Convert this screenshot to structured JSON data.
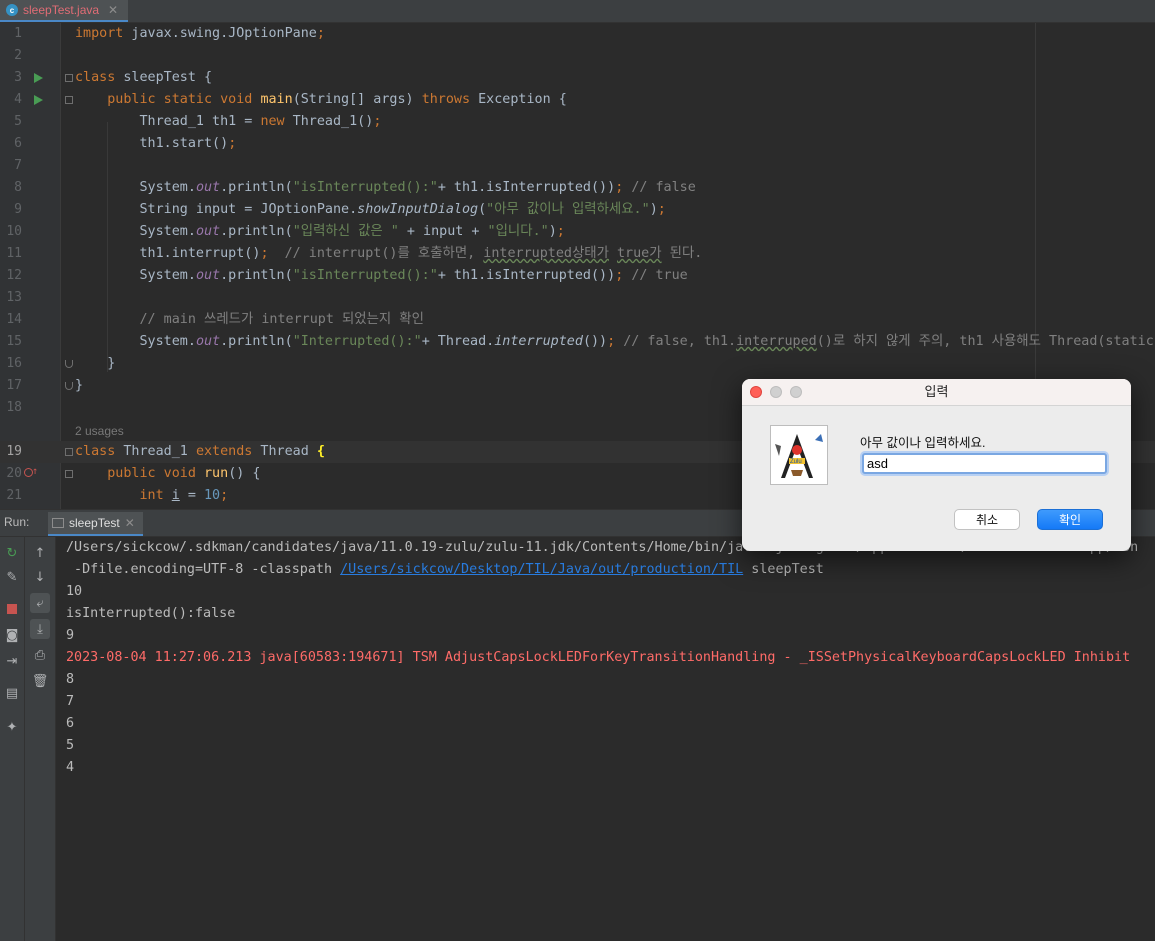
{
  "file_tab": {
    "name": "sleepTest.java",
    "icon": "c"
  },
  "editor": {
    "usages_hint": "2 usages",
    "line_numbers": [
      "1",
      "2",
      "3",
      "4",
      "5",
      "6",
      "7",
      "8",
      "9",
      "10",
      "11",
      "12",
      "13",
      "14",
      "15",
      "16",
      "17",
      "18",
      "19",
      "20",
      "21"
    ]
  },
  "run_panel": {
    "label": "Run:",
    "tab_name": "sleepTest",
    "console_lines": [
      "/Users/sickcow/.sdkman/candidates/java/11.0.19-zulu/zulu-11.jdk/Contents/Home/bin/java -javaagent:/Applications/IntelliJ IDEA.app/Con",
      " -Dfile.encoding=UTF-8 -classpath ",
      "/Users/sickcow/Desktop/TIL/Java/out/production/TIL",
      " sleepTest",
      "10",
      "isInterrupted():false",
      "9",
      "2023-08-04 11:27:06.213 java[60583:194671] TSM AdjustCapsLockLEDForKeyTransitionHandling - _ISSetPhysicalKeyboardCapsLockLED Inhibit",
      "8",
      "7",
      "6",
      "5",
      "4"
    ]
  },
  "dialog": {
    "title": "입력",
    "message": "아무 값이나 입력하세요.",
    "input_value": "asd",
    "cancel_label": "취소",
    "ok_label": "확인",
    "icon_text": "Zulu"
  },
  "colors": {
    "keyword": "#cc7832",
    "string": "#6a8759",
    "comment": "#808080",
    "function": "#ffc66d",
    "error_text": "#ff6b68",
    "link": "#287bde",
    "ok_button": "#1479f7"
  }
}
